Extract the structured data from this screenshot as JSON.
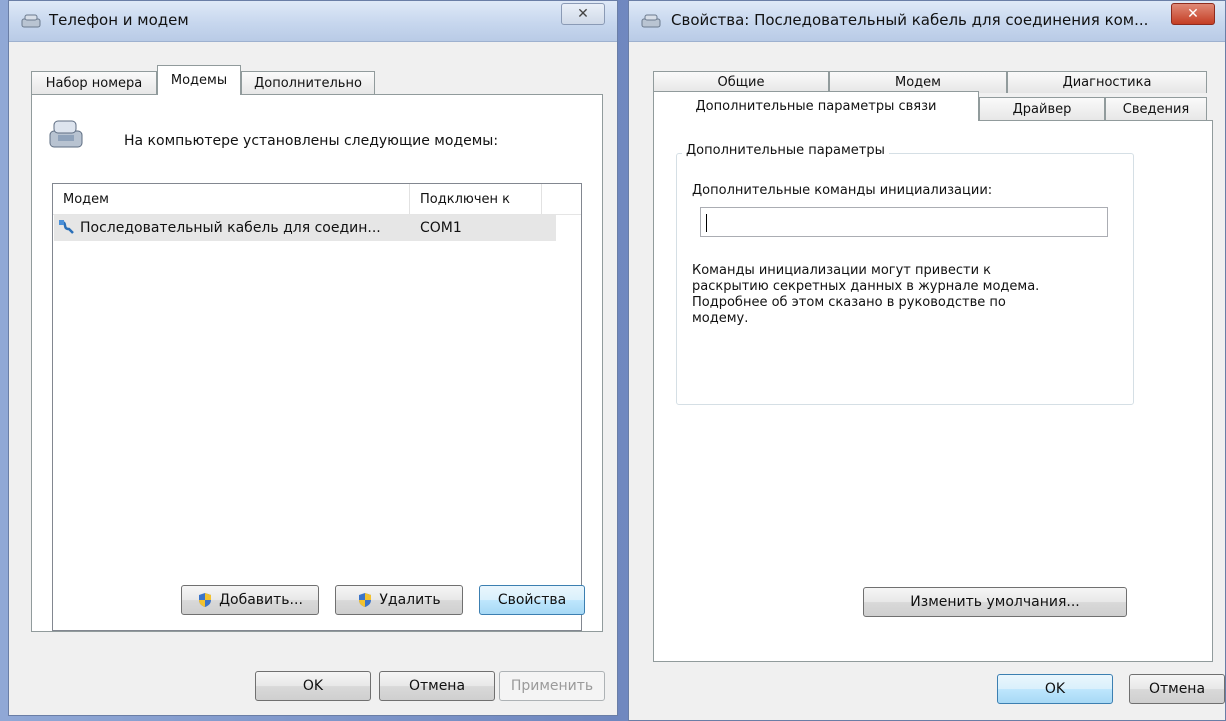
{
  "window1": {
    "title": "Телефон и модем",
    "tabs": [
      "Набор номера",
      "Модемы",
      "Дополнительно"
    ],
    "active_tab": "Модемы",
    "intro_text": "На компьютере установлены следующие модемы:",
    "table": {
      "columns": [
        "Модем",
        "Подключен к"
      ],
      "rows": [
        {
          "modem": "Последовательный кабель для соедин...",
          "port": "COM1"
        }
      ]
    },
    "buttons": {
      "add": "Добавить...",
      "remove": "Удалить",
      "properties": "Свойства"
    },
    "footer": {
      "ok": "OK",
      "cancel": "Отмена",
      "apply": "Применить"
    }
  },
  "window2": {
    "title": "Свойства: Последовательный кабель для соединения ком...",
    "tabs_top": [
      "Общие",
      "Модем",
      "Диагностика"
    ],
    "tabs_bottom": [
      "Дополнительные параметры связи",
      "Драйвер",
      "Сведения"
    ],
    "active_tab": "Дополнительные параметры связи",
    "group_title": "Дополнительные параметры",
    "init_label": "Дополнительные команды инициализации:",
    "init_value": "",
    "note_lines": [
      "Команды инициализации могут привести к",
      "раскрытию секретных данных в журнале модема.",
      "Подробнее об этом сказано в руководстве по",
      "модему."
    ],
    "change_defaults_button": "Изменить умолчания...",
    "footer": {
      "ok": "OK",
      "cancel": "Отмена"
    }
  },
  "colors": {
    "title_bar": "#c7d7ee",
    "default_button": "#bee6fd",
    "close_button_red": "#c43d24",
    "selected_row": "#e6e6e6"
  },
  "icons": [
    "phone-modem-icon",
    "serial-cable-icon",
    "uac-shield-icon",
    "close-icon"
  ]
}
